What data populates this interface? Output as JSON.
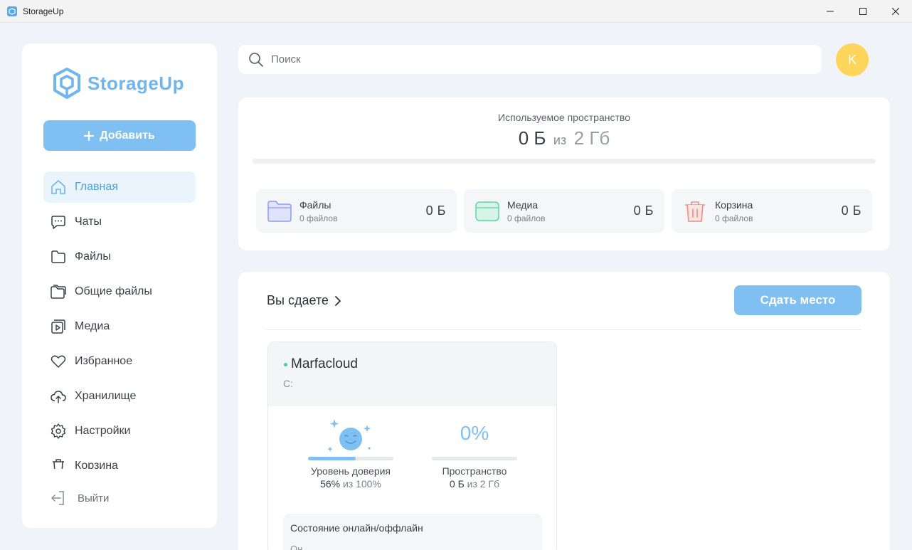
{
  "window": {
    "title": "StorageUp"
  },
  "brand": {
    "name": "StorageUp",
    "accent": "#7fbff2"
  },
  "sidebar": {
    "add_label": "Добавить",
    "items": [
      {
        "label": "Главная",
        "icon": "home-icon",
        "active": true
      },
      {
        "label": "Чаты",
        "icon": "chat-icon"
      },
      {
        "label": "Файлы",
        "icon": "folder-icon"
      },
      {
        "label": "Общие файлы",
        "icon": "shared-folder-icon"
      },
      {
        "label": "Медиа",
        "icon": "media-icon"
      },
      {
        "label": "Избранное",
        "icon": "heart-icon"
      },
      {
        "label": "Хранилище",
        "icon": "cloud-upload-icon"
      },
      {
        "label": "Настройки",
        "icon": "gear-icon"
      },
      {
        "label": "Корзина",
        "icon": "trash-icon"
      }
    ],
    "logout_label": "Выйти"
  },
  "search": {
    "placeholder": "Поиск",
    "value": ""
  },
  "user": {
    "avatar_letter": "K",
    "avatar_color": "#fdd55a"
  },
  "usage": {
    "title": "Используемое пространство",
    "used": "0 Б",
    "of": "из",
    "total": "2 Гб",
    "fraction": 0,
    "categories": [
      {
        "name": "Файлы",
        "count": "0 файлов",
        "size": "0 Б",
        "icon": "folder-icon",
        "color": "#8f9cf0"
      },
      {
        "name": "Медиа",
        "count": "0 файлов",
        "size": "0 Б",
        "icon": "media-icon",
        "color": "#5fd3a5"
      },
      {
        "name": "Корзина",
        "count": "0 файлов",
        "size": "0 Б",
        "icon": "trash-icon",
        "color": "#f28b82"
      }
    ]
  },
  "lending": {
    "title": "Вы сдаете",
    "action_label": "Сдать место",
    "storage": {
      "name": "Marfacloud",
      "drive": "C:",
      "online": true,
      "trust": {
        "label": "Уровень доверия",
        "value": "56%",
        "of": "из 100%",
        "fraction": 0.56
      },
      "space": {
        "percent": "0%",
        "label": "Пространство",
        "value": "0 Б",
        "of": "из 2 Гб",
        "fraction": 0
      },
      "status": {
        "title": "Состояние онлайн/оффлайн",
        "sub": "Он"
      }
    }
  }
}
